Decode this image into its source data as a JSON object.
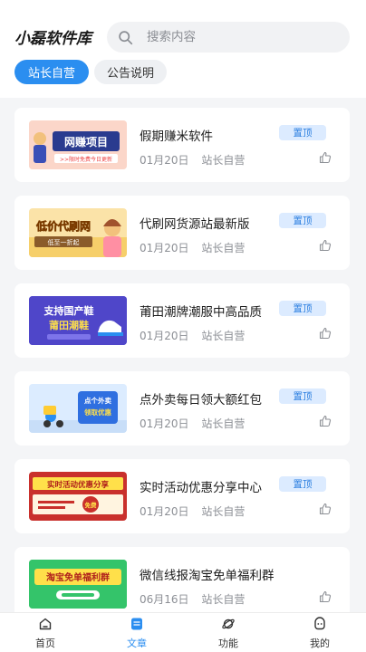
{
  "header": {
    "app_title": "小磊软件库",
    "search_placeholder": "搜索内容"
  },
  "tabs": [
    {
      "label": "站长自营",
      "active": true
    },
    {
      "label": "公告说明",
      "active": false
    }
  ],
  "articles": [
    {
      "title": "假期赚米软件",
      "date": "01月20日",
      "author": "站长自营",
      "badge": "置顶",
      "thumb_text": [
        "网赚项目",
        ">>限时免费今日更新"
      ]
    },
    {
      "title": "代刷网货源站最新版",
      "date": "01月20日",
      "author": "站长自营",
      "badge": "置顶",
      "thumb_text": [
        "低价代刷网",
        "低至一折起"
      ]
    },
    {
      "title": "莆田潮牌潮服中高品质",
      "date": "01月20日",
      "author": "站长自营",
      "badge": "置顶",
      "thumb_text": [
        "支持国产鞋",
        "莆田潮鞋"
      ]
    },
    {
      "title": "点外卖每日领大额红包",
      "date": "01月20日",
      "author": "站长自营",
      "badge": "置顶",
      "thumb_text": [
        "点个外卖",
        "领取优惠"
      ]
    },
    {
      "title": "实时活动优惠分享中心",
      "date": "01月20日",
      "author": "站长自营",
      "badge": "置顶",
      "thumb_text": [
        "实时活动优惠分享",
        "免费"
      ]
    },
    {
      "title": "微信线报淘宝免单福利群",
      "date": "06月16日",
      "author": "站长自营",
      "badge": "",
      "thumb_text": [
        "淘宝免单福利群"
      ]
    }
  ],
  "tabbar": [
    {
      "label": "首页",
      "icon": "home-icon",
      "active": false
    },
    {
      "label": "文章",
      "icon": "article-icon",
      "active": true
    },
    {
      "label": "功能",
      "icon": "planet-icon",
      "active": false
    },
    {
      "label": "我的",
      "icon": "profile-icon",
      "active": false
    }
  ],
  "colors": {
    "accent": "#2b8ef0",
    "badge_bg": "#dcebff",
    "badge_text": "#2b7fe0",
    "page_bg": "#f4f5f7"
  }
}
